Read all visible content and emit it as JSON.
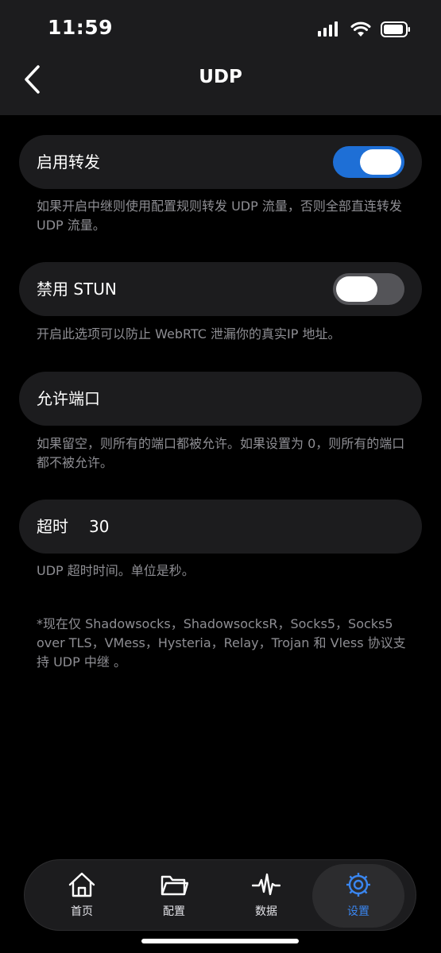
{
  "status_bar": {
    "time": "11:59"
  },
  "nav": {
    "title": "UDP"
  },
  "settings": {
    "forwarding": {
      "label": "启用转发",
      "enabled": true,
      "description": "如果开启中继则使用配置规则转发 UDP 流量，否则全部直连转发 UDP 流量。"
    },
    "disable_stun": {
      "label": "禁用 STUN",
      "enabled": false,
      "description": "开启此选项可以防止 WebRTC 泄漏你的真实IP 地址。"
    },
    "allowed_ports": {
      "label": "允许端口",
      "value": "",
      "description": "如果留空，则所有的端口都被允许。如果设置为 0，则所有的端口都不被允许。"
    },
    "timeout": {
      "label": "超时",
      "value": "30",
      "description": "UDP 超时时间。单位是秒。"
    },
    "footnote": "*现在仅 Shadowsocks，ShadowsocksR，Socks5，Socks5 over TLS，VMess，Hysteria，Relay，Trojan 和 Vless 协议支持 UDP 中继 。"
  },
  "tab_bar": {
    "active": "settings",
    "tabs": [
      {
        "id": "home",
        "label": "首页",
        "icon": "home-icon"
      },
      {
        "id": "config",
        "label": "配置",
        "icon": "folder-icon"
      },
      {
        "id": "data",
        "label": "数据",
        "icon": "activity-icon"
      },
      {
        "id": "settings",
        "label": "设置",
        "icon": "gear-icon"
      }
    ]
  },
  "colors": {
    "accent": "#1e6fd6",
    "active_tab": "#3a86f0",
    "card": "#1c1c1e",
    "secondary_text": "#8e8e93"
  }
}
